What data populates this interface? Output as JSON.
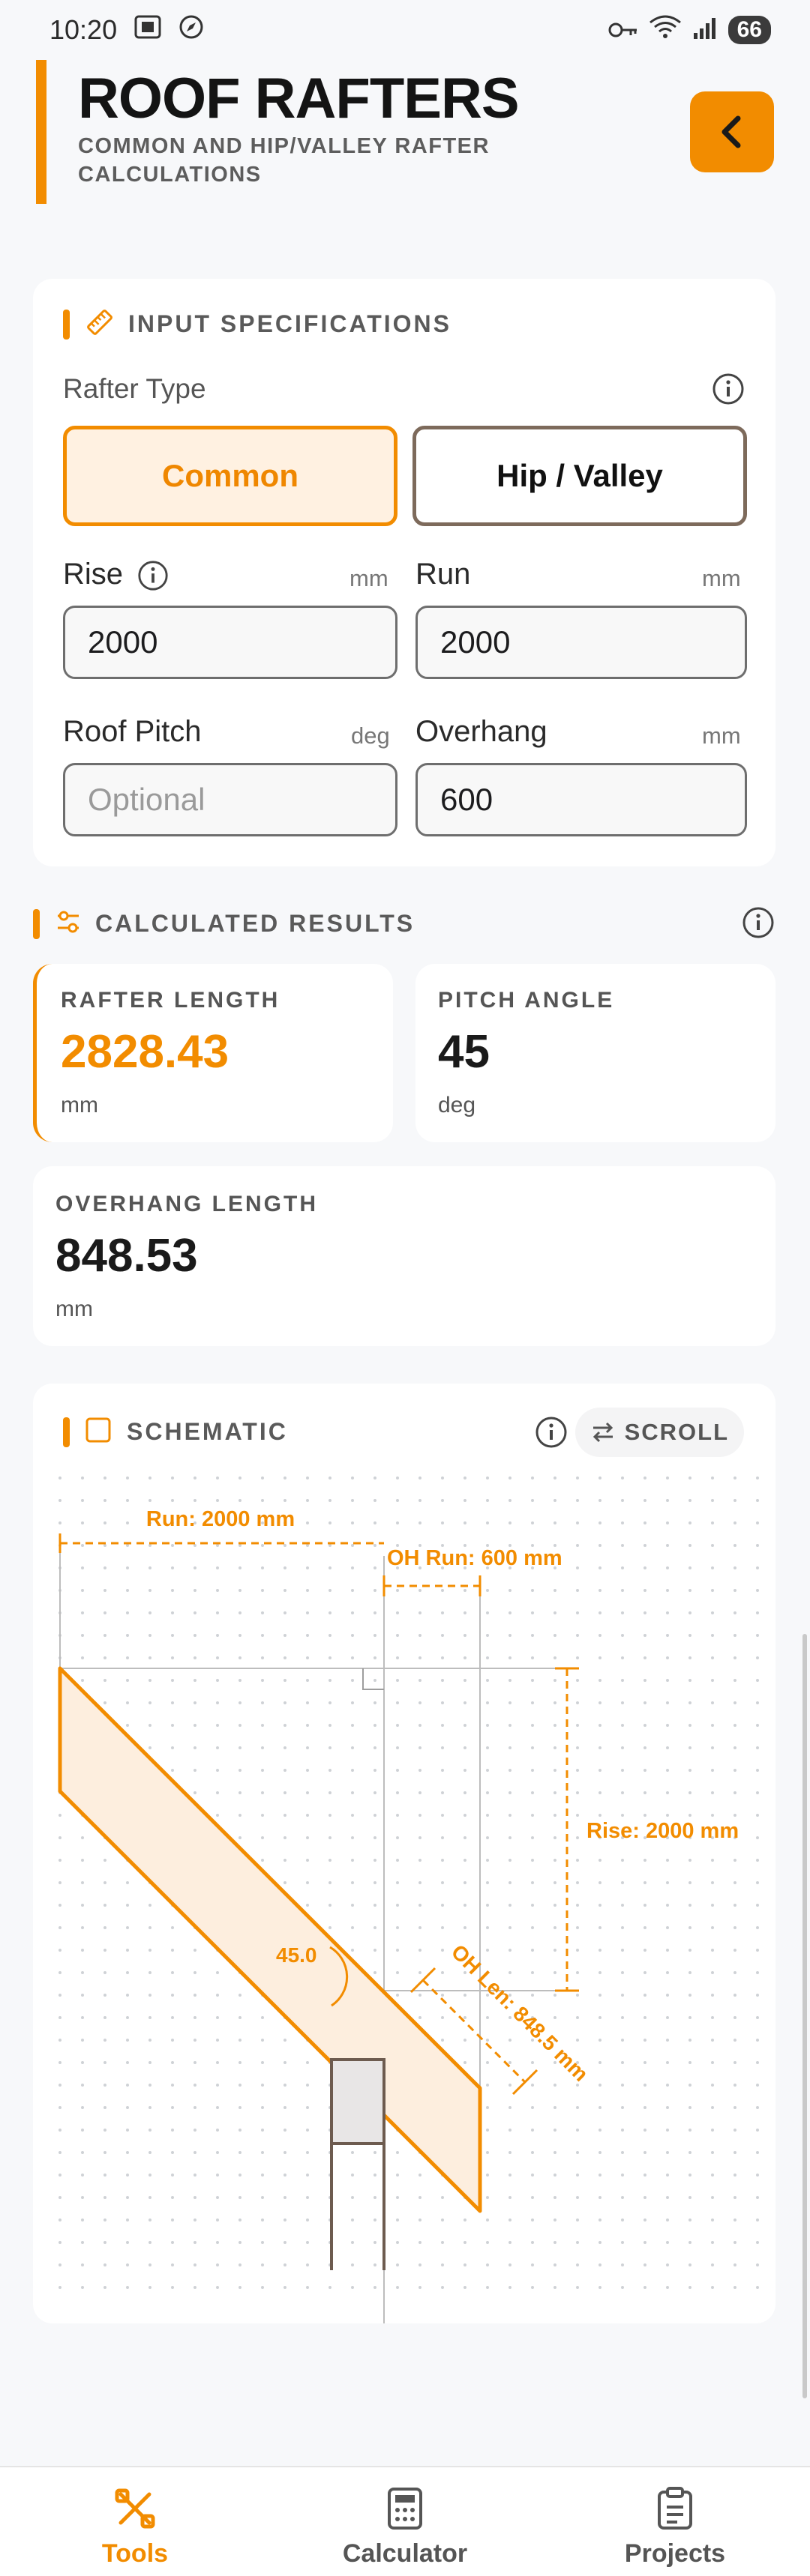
{
  "status_bar": {
    "time": "10:20",
    "battery": "66"
  },
  "header": {
    "title": "ROOF RAFTERS",
    "subtitle": "COMMON AND HIP/VALLEY RAFTER CALCULATIONS"
  },
  "inputs": {
    "section_title": "INPUT SPECIFICATIONS",
    "rafter_type_label": "Rafter Type",
    "rafter_types": [
      "Common",
      "Hip / Valley"
    ],
    "selected_type": "Common",
    "rise": {
      "label": "Rise",
      "unit": "mm",
      "value": "2000"
    },
    "run": {
      "label": "Run",
      "unit": "mm",
      "value": "2000"
    },
    "pitch": {
      "label": "Roof Pitch",
      "unit": "deg",
      "value": "",
      "placeholder": "Optional"
    },
    "overhang": {
      "label": "Overhang",
      "unit": "mm",
      "value": "600"
    }
  },
  "results": {
    "section_title": "CALCULATED RESULTS",
    "rafter_length": {
      "label": "RAFTER LENGTH",
      "value": "2828.43",
      "unit": "mm"
    },
    "pitch_angle": {
      "label": "PITCH ANGLE",
      "value": "45",
      "unit": "deg"
    },
    "overhang_length": {
      "label": "OVERHANG LENGTH",
      "value": "848.53",
      "unit": "mm"
    }
  },
  "schematic": {
    "section_title": "SCHEMATIC",
    "scroll_label": "SCROLL",
    "run_label": "Run: 2000 mm",
    "oh_run_label": "OH Run: 600 mm",
    "rise_label": "Rise: 2000 mm",
    "angle_label": "45.0",
    "oh_len_label": "OH Len: 848.5 mm"
  },
  "bottom_nav": {
    "items": [
      {
        "label": "Tools",
        "icon": "tools-icon",
        "active": true
      },
      {
        "label": "Calculator",
        "icon": "calculator-icon",
        "active": false
      },
      {
        "label": "Projects",
        "icon": "clipboard-icon",
        "active": false
      }
    ]
  },
  "colors": {
    "accent": "#f28c00",
    "accent_light": "#fff1e1",
    "background": "#f7f8fa"
  }
}
